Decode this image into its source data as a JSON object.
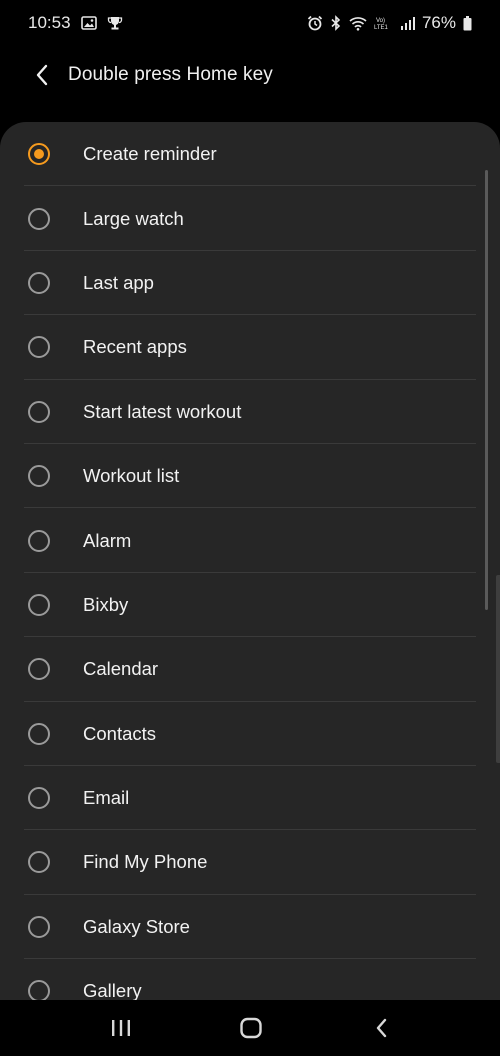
{
  "status_bar": {
    "time": "10:53",
    "battery": "76%",
    "left_icons": [
      "gallery-icon",
      "trophy-icon"
    ],
    "right_icons": [
      "alarm-icon",
      "bluetooth-icon",
      "wifi-icon",
      "volte-lte-icon",
      "signal-icon",
      "battery-icon"
    ]
  },
  "header": {
    "title": "Double press Home key",
    "back_icon": "chevron-left-icon"
  },
  "options": {
    "selected_index": 0,
    "items": [
      {
        "label": "Create reminder",
        "selected": true
      },
      {
        "label": "Large watch",
        "selected": false
      },
      {
        "label": "Last app",
        "selected": false
      },
      {
        "label": "Recent apps",
        "selected": false
      },
      {
        "label": "Start latest workout",
        "selected": false
      },
      {
        "label": "Workout list",
        "selected": false
      },
      {
        "label": "Alarm",
        "selected": false
      },
      {
        "label": "Bixby",
        "selected": false
      },
      {
        "label": "Calendar",
        "selected": false
      },
      {
        "label": "Contacts",
        "selected": false
      },
      {
        "label": "Email",
        "selected": false
      },
      {
        "label": "Find My Phone",
        "selected": false
      },
      {
        "label": "Galaxy Store",
        "selected": false
      },
      {
        "label": "Gallery",
        "selected": false
      }
    ]
  },
  "nav_bar": {
    "buttons": [
      "recent-apps-icon",
      "home-icon",
      "back-icon"
    ]
  },
  "colors": {
    "accent": "#f59a1e",
    "card_background": "#262626",
    "screen_background": "#000000"
  }
}
